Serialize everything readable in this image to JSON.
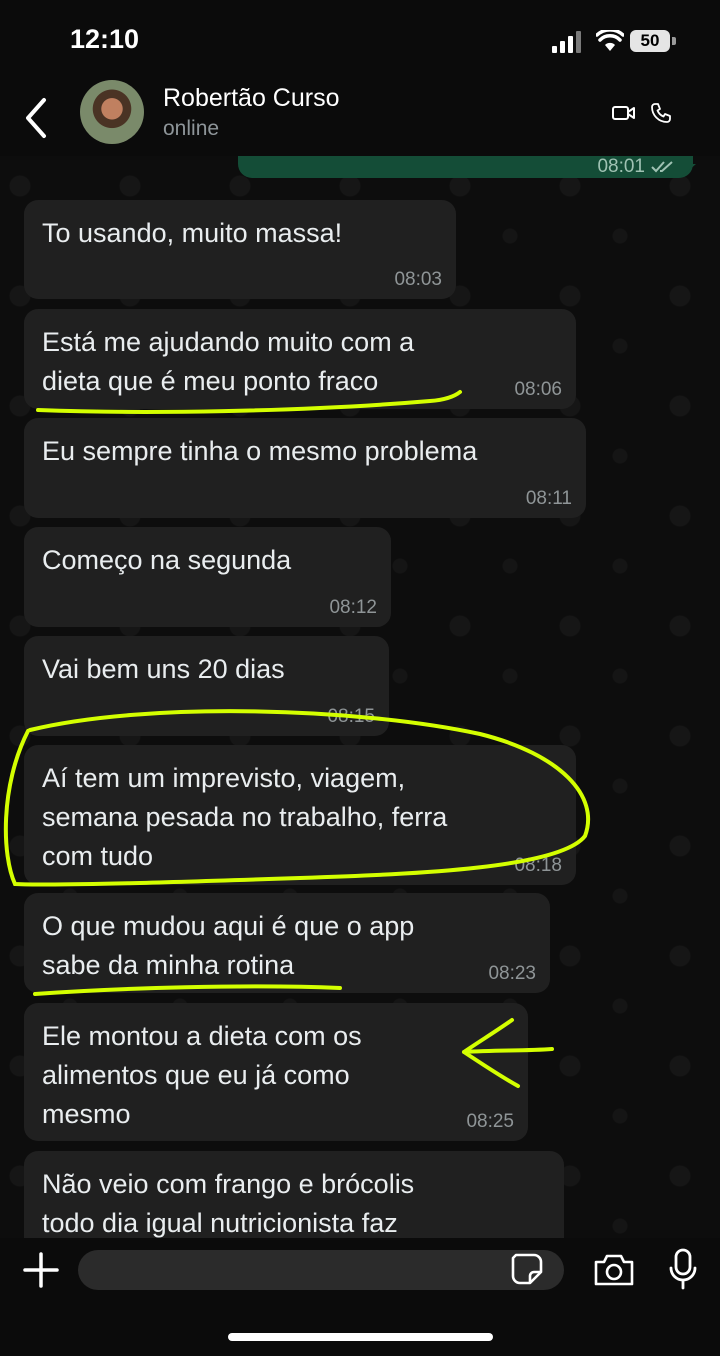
{
  "status": {
    "time": "12:10",
    "battery": "50"
  },
  "header": {
    "contact_name": "Robertão Curso",
    "presence": "online"
  },
  "chat": {
    "partial_sent_time": "08:01",
    "messages": [
      {
        "text": "To usando, muito massa!",
        "time": "08:03"
      },
      {
        "text": "Está me ajudando muito com a\ndieta que é meu ponto fraco",
        "time": "08:06"
      },
      {
        "text": "Eu sempre tinha o mesmo problema",
        "time": "08:11"
      },
      {
        "text": "Começo na segunda",
        "time": "08:12"
      },
      {
        "text": "Vai bem uns 20 dias",
        "time": "08:15"
      },
      {
        "text": "Aí tem um imprevisto, viagem,\nsemana pesada no trabalho, ferra\ncom tudo",
        "time": "08:18"
      },
      {
        "text": "O que mudou aqui é que o app\nsabe da minha rotina",
        "time": "08:23"
      },
      {
        "text": "Ele montou a dieta com os\nalimentos que eu já como\nmesmo",
        "time": "08:25"
      },
      {
        "text": "Não veio com frango e brócolis\ntodo dia igual nutricionista faz",
        "time": ""
      }
    ]
  },
  "input": {
    "placeholder": ""
  },
  "colors": {
    "sent_bubble": "#144d37",
    "received_bubble": "#202020",
    "highlight": "#d4ff00"
  }
}
